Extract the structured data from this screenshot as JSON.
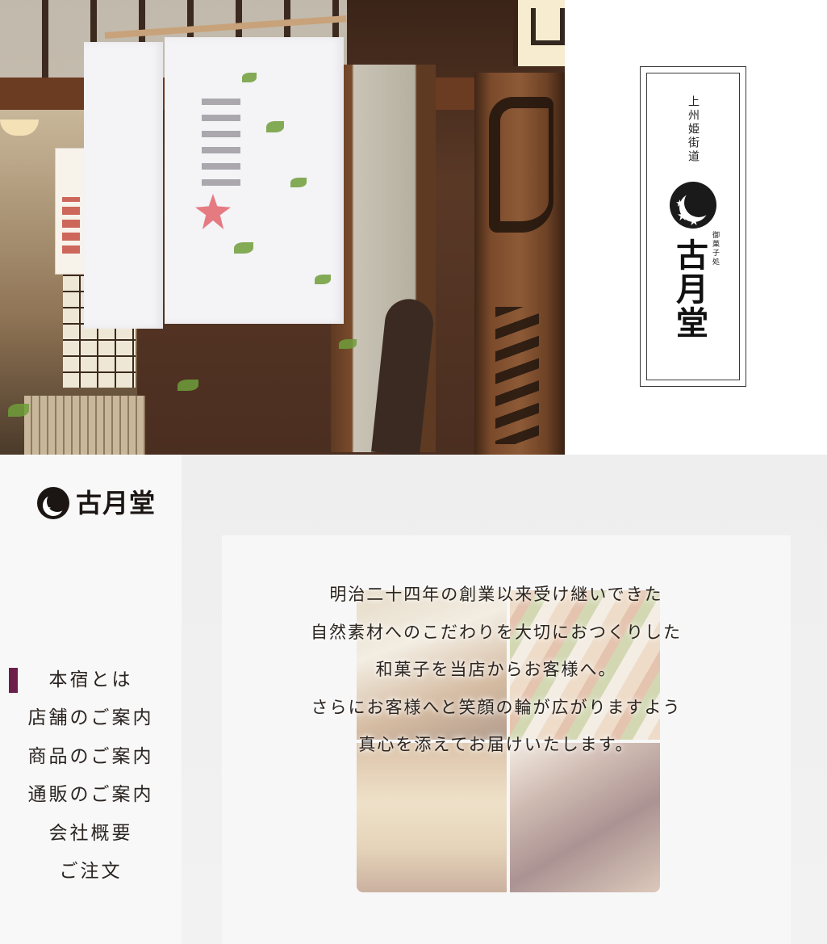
{
  "logo_card": {
    "tagline": "上州姫街道",
    "subtitle": "御菓子処",
    "name": "古月堂"
  },
  "brand": {
    "name": "古月堂"
  },
  "nav": {
    "items": [
      {
        "label": "本宿とは",
        "active": true
      },
      {
        "label": "店舗のご案内",
        "active": false
      },
      {
        "label": "商品のご案内",
        "active": false
      },
      {
        "label": "通販のご案内",
        "active": false
      },
      {
        "label": "会社概要",
        "active": false
      },
      {
        "label": "ご注文",
        "active": false
      }
    ]
  },
  "intro": {
    "lines": [
      "明治二十四年の創業以来受け継いできた",
      "自然素材へのこだわりを大切におつくりした",
      "和菓子を当店からお客様へ。",
      "さらにお客様へと笑顔の輪が広がりますよう",
      "真心を添えてお届けいたします。"
    ]
  },
  "colors": {
    "accent": "#6b1f4a",
    "text": "#2a2421",
    "sidebar_bg": "#f9f8f8"
  },
  "icons": {
    "emblem": "crescent-moon-maple-emblem"
  }
}
